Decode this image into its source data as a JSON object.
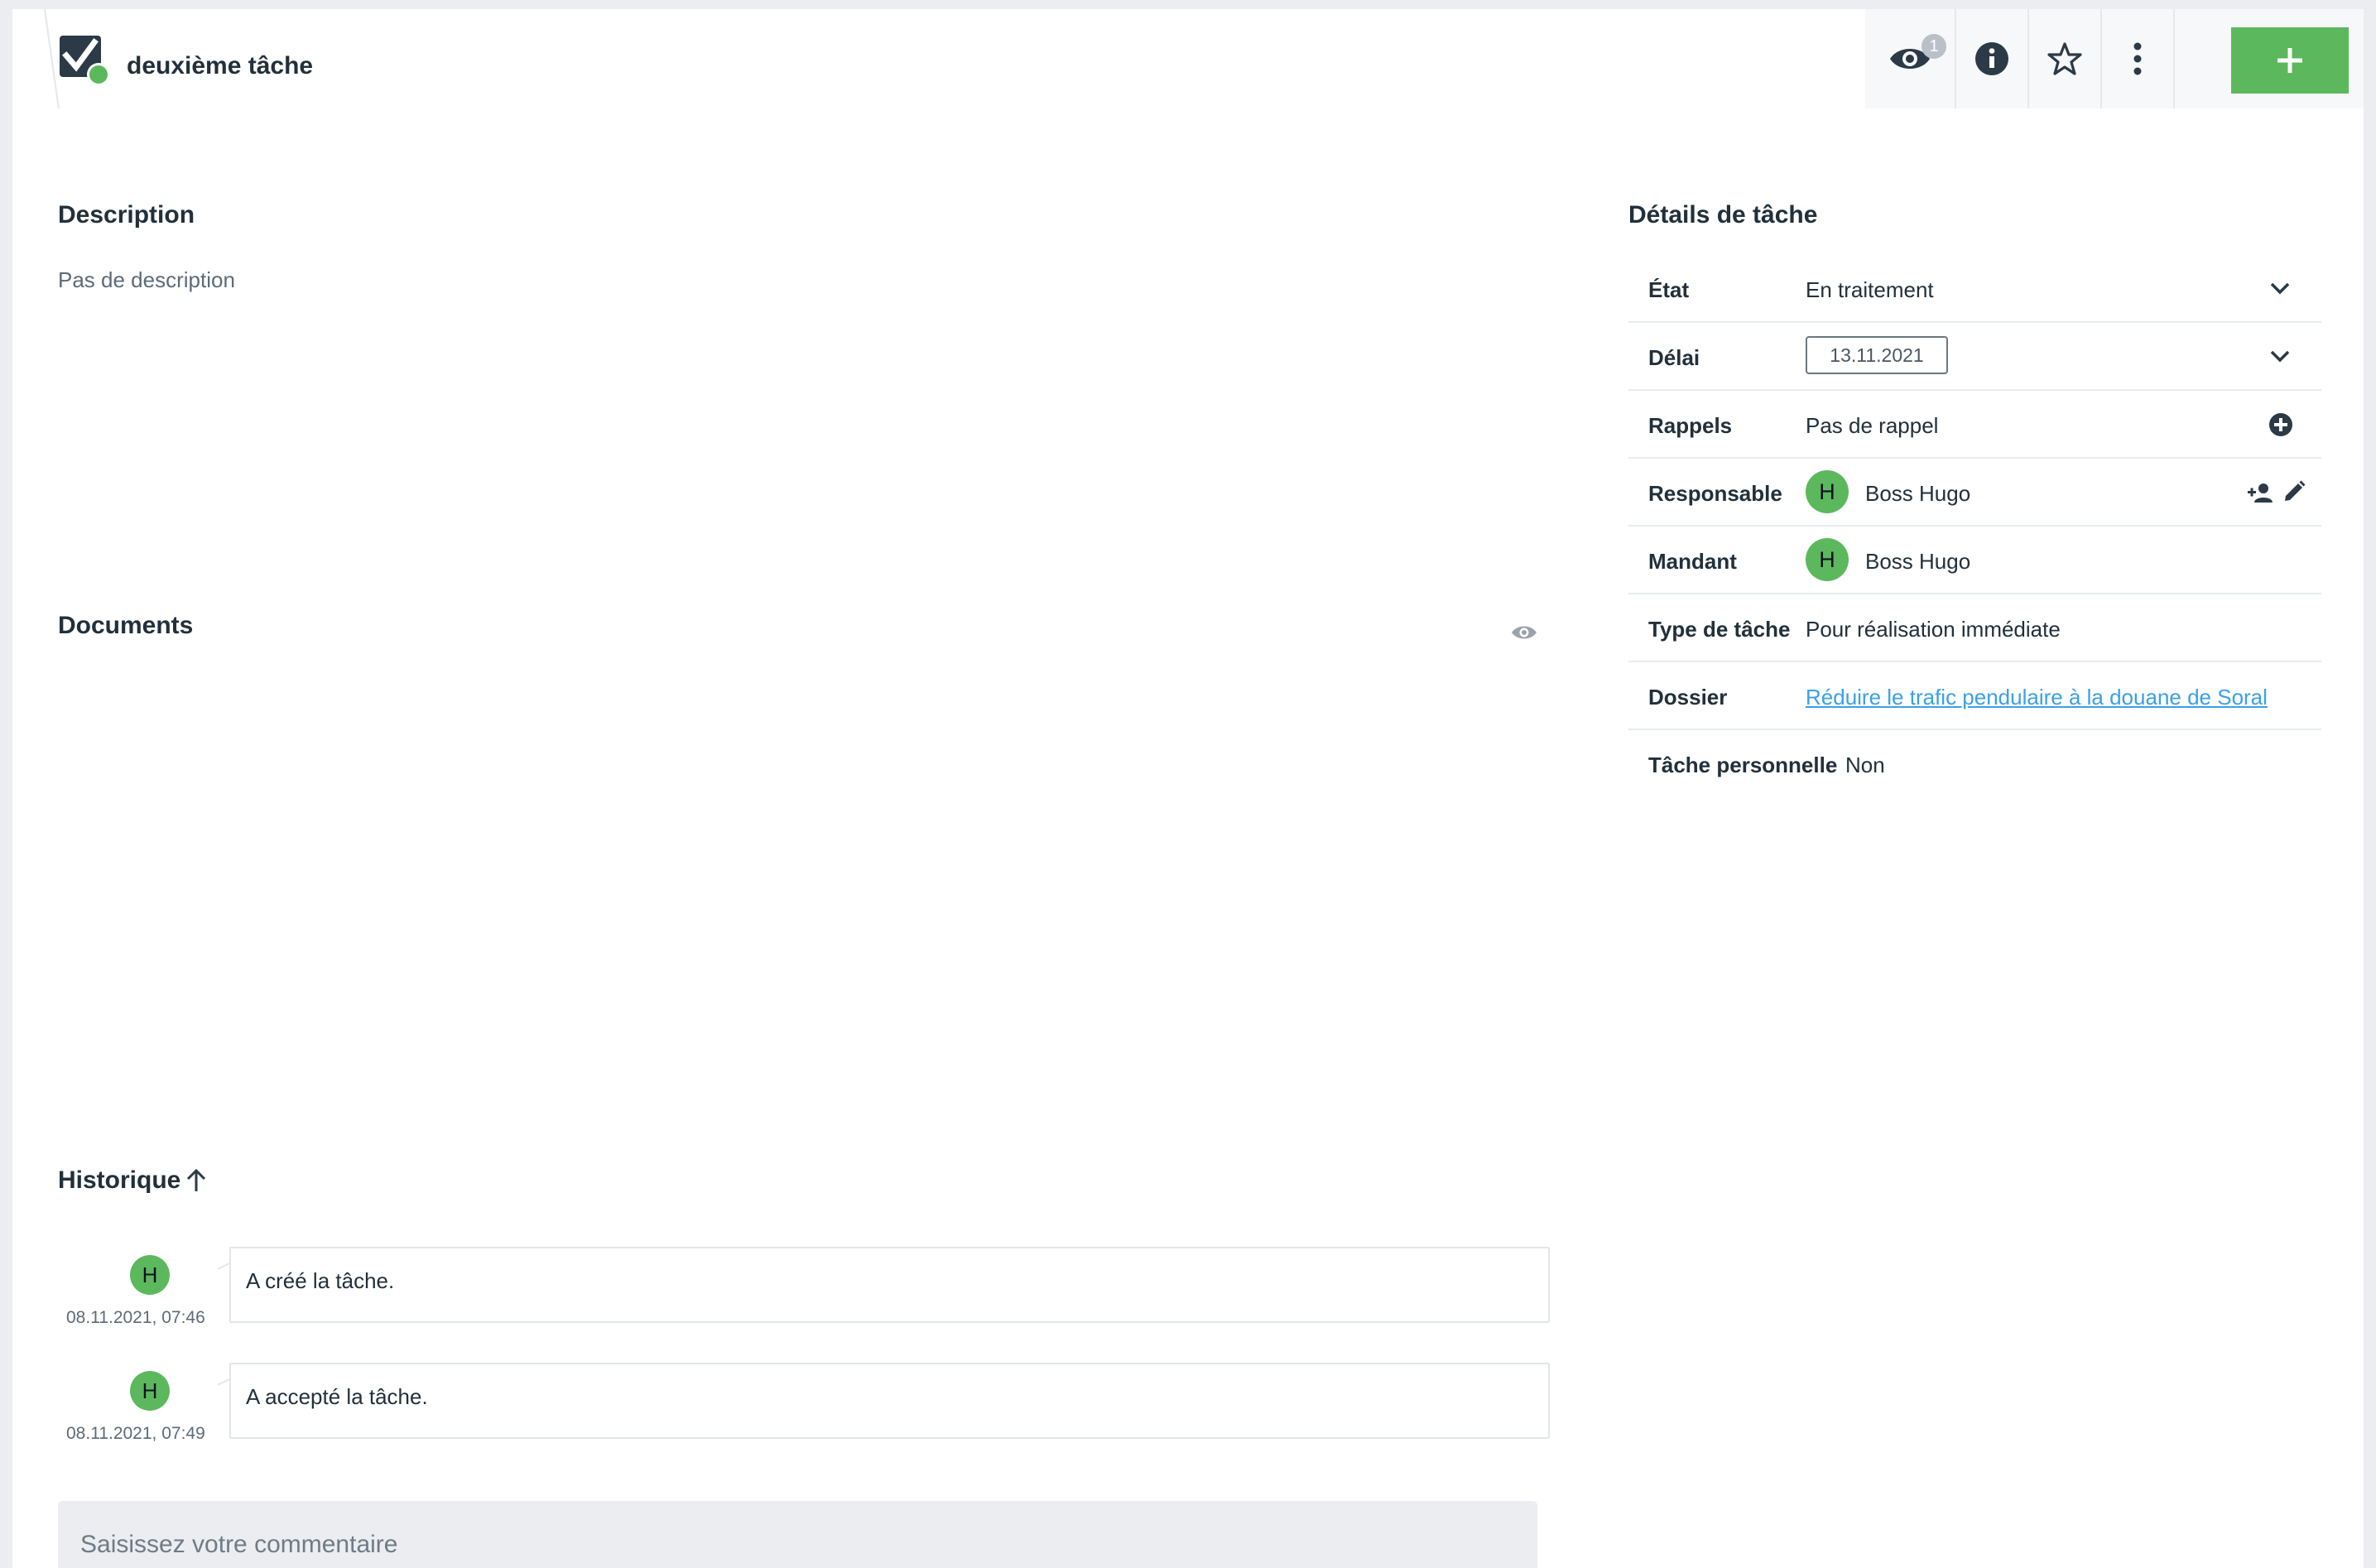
{
  "header": {
    "title": "deuxième tâche",
    "watch_count": "1"
  },
  "colors": {
    "accent_green": "#5cb85c",
    "link_blue": "#3ba0e4"
  },
  "description": {
    "title": "Description",
    "text": "Pas de description"
  },
  "documents": {
    "title": "Documents"
  },
  "history": {
    "title": "Historique",
    "items": [
      {
        "avatar": "H",
        "date": "08.11.2021, 07:46",
        "text": "A créé la tâche."
      },
      {
        "avatar": "H",
        "date": "08.11.2021, 07:49",
        "text": "A accepté la tâche."
      }
    ]
  },
  "comment": {
    "placeholder": "Saisissez votre commentaire"
  },
  "details": {
    "title": "Détails de tâche",
    "rows": {
      "etat": {
        "label": "État",
        "value": "En traitement"
      },
      "delai": {
        "label": "Délai",
        "value": "13.11.2021"
      },
      "rappels": {
        "label": "Rappels",
        "value": "Pas de rappel"
      },
      "responsable": {
        "label": "Responsable",
        "avatar": "H",
        "value": "Boss Hugo"
      },
      "mandant": {
        "label": "Mandant",
        "avatar": "H",
        "value": "Boss Hugo"
      },
      "type": {
        "label": "Type de tâche",
        "value": "Pour réalisation immédiate"
      },
      "dossier": {
        "label": "Dossier",
        "value": "Réduire le trafic pendulaire à la douane de Soral"
      },
      "personnelle": {
        "label": "Tâche personnelle",
        "value": "Non"
      }
    }
  }
}
